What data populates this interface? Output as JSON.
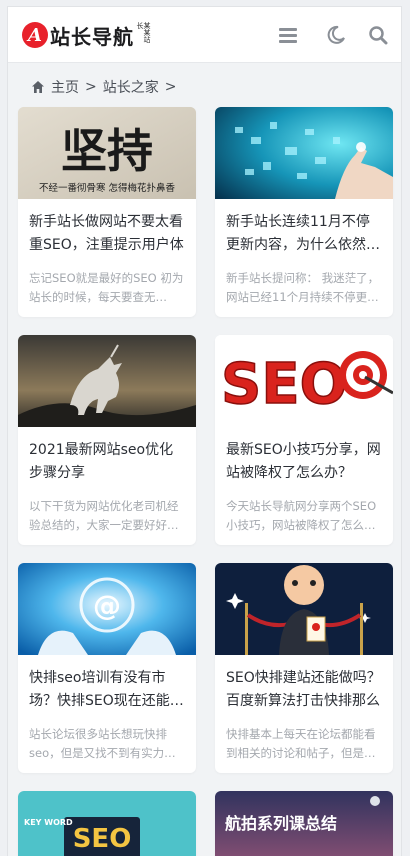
{
  "header": {
    "logo_letter": "A",
    "logo_text": "站长导航",
    "logo_subtext": "某某站长",
    "menu_icon": "menu-icon",
    "theme_icon": "moon-icon",
    "search_icon": "search-icon"
  },
  "breadcrumb": {
    "home_icon": "home-icon",
    "items": [
      "主页",
      "站长之家"
    ],
    "separator": ">"
  },
  "thumb_texts": {
    "card1_big": "坚持",
    "card1_small": "不经一番彻骨寒 怎得梅花扑鼻香",
    "card4_seo": "SEO",
    "card7_keyword": "KEY WORD",
    "card7_seo": "SEO",
    "card8_banner": "航拍系列课总结"
  },
  "articles": [
    {
      "title": "新手站长做网站不要太看重SEO，注重提示用户体",
      "excerpt": "忘记SEO就是最好的SEO 初为站长的时候，每天要查无…"
    },
    {
      "title": "新手站长连续11月不停更新内容，为什么依然…",
      "excerpt": "新手站长提问称： 我迷茫了，网站已经11个月持续不停更…"
    },
    {
      "title": "2021最新网站seo优化步骤分享",
      "excerpt": "以下干货为网站优化老司机经验总结的，大家一定要好好…"
    },
    {
      "title": "最新SEO小技巧分享，网站被降权了怎么办？",
      "excerpt": "今天站长导航网分享两个SEO小技巧，网站被降权了怎么…"
    },
    {
      "title": "快排seo培训有没有市场？快排SEO现在还能…",
      "excerpt": "站长论坛很多站长想玩快排seo，但是又找不到有实力…"
    },
    {
      "title": "SEO快排建站还能做吗？百度新算法打击快排那么",
      "excerpt": "快排基本上每天在论坛都能看到相关的讨论和帖子，但是…"
    }
  ],
  "colors": {
    "brand_red": "#e8212b",
    "text_dark": "#2b2f36",
    "text_muted": "#a4a8ae",
    "page_bg": "#f1f3f5"
  }
}
